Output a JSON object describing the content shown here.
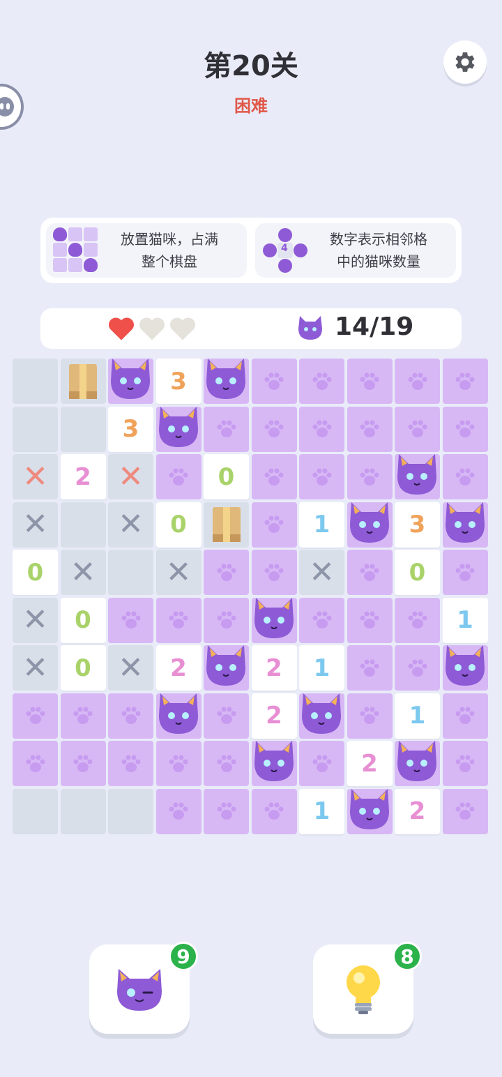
{
  "header": {
    "level_title": "第20关",
    "difficulty": "困难"
  },
  "rules": [
    {
      "text_line1": "放置猫咪，占满",
      "text_line2": "整个棋盘",
      "icon": "cat-grid-icon"
    },
    {
      "text_line1": "数字表示相邻格",
      "text_line2": "中的猫咪数量",
      "icon": "cat-neighbors-icon",
      "icon_number": "4"
    }
  ],
  "status": {
    "lives_total": 3,
    "lives_remaining": 1,
    "cat_count": "14/19"
  },
  "colors": {
    "heart_full": "#f0504a",
    "heart_empty": "#e5e2dc",
    "cat_purple": "#8e5ad6",
    "paw_cell": "#d7b8f5",
    "empty_cell": "#d9dfe9",
    "badge_green": "#2cb24a"
  },
  "board": {
    "size": 10,
    "rows": [
      [
        "E",
        "B",
        "C",
        "3",
        "C",
        "P",
        "P",
        "P",
        "P",
        "P"
      ],
      [
        "E",
        "E",
        "3",
        "C",
        "P",
        "P",
        "P",
        "P",
        "P",
        "P"
      ],
      [
        "XR",
        "2",
        "XR",
        "P",
        "0",
        "P",
        "P",
        "P",
        "C",
        "P"
      ],
      [
        "X",
        "E",
        "X",
        "0",
        "B",
        "P",
        "1",
        "C",
        "3",
        "C"
      ],
      [
        "0",
        "X",
        "E",
        "X",
        "P",
        "P",
        "X",
        "P",
        "0",
        "P"
      ],
      [
        "X",
        "0",
        "P",
        "P",
        "P",
        "C",
        "P",
        "P",
        "P",
        "1"
      ],
      [
        "X",
        "0",
        "X",
        "2",
        "C",
        "2",
        "1",
        "P",
        "P",
        "C"
      ],
      [
        "P",
        "P",
        "P",
        "C",
        "P",
        "2",
        "C",
        "P",
        "1",
        "P"
      ],
      [
        "P",
        "P",
        "P",
        "P",
        "P",
        "C",
        "P",
        "2",
        "C",
        "P"
      ],
      [
        "E",
        "E",
        "E",
        "P",
        "P",
        "P",
        "1",
        "C",
        "2",
        "P"
      ]
    ],
    "legend": {
      "E": "empty",
      "B": "box",
      "C": "cat",
      "P": "paw",
      "X": "cross",
      "XR": "cross-red",
      "digits": "number clue"
    }
  },
  "buttons": {
    "place_cat": {
      "badge": "9",
      "icon": "cat-wink-icon"
    },
    "hint": {
      "badge": "8",
      "icon": "lightbulb-icon"
    }
  }
}
